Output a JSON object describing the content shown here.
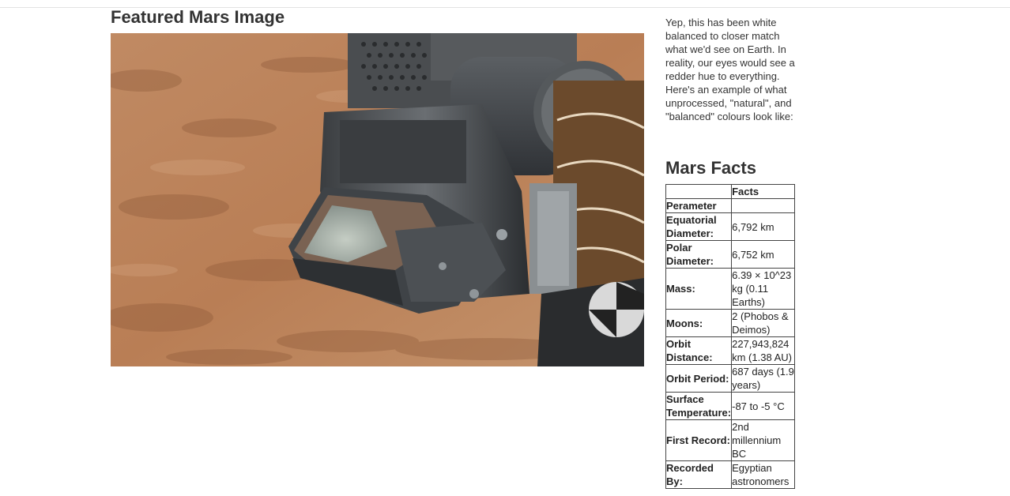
{
  "featured": {
    "title": "Featured Mars Image",
    "image_alt": "Curiosity rover scoop holding sampled soil against Martian terrain"
  },
  "note": {
    "text": "Yep, this has been white balanced to closer match what we'd see on Earth. In reality, our eyes would see a redder hue to everything. Here's an example of what unprocessed, \"natural\", and \"balanced\" colours look like:"
  },
  "facts": {
    "title": "Mars Facts",
    "header": [
      "",
      "Facts"
    ],
    "rows": [
      {
        "label": "Perameter",
        "value": ""
      },
      {
        "label": "Equatorial Diameter:",
        "value": "6,792 km"
      },
      {
        "label": "Polar Diameter:",
        "value": "6,752 km"
      },
      {
        "label": "Mass:",
        "value": "6.39 × 10^23 kg (0.11 Earths)"
      },
      {
        "label": "Moons:",
        "value": "2 (Phobos & Deimos)"
      },
      {
        "label": "Orbit Distance:",
        "value": "227,943,824 km (1.38 AU)"
      },
      {
        "label": "Orbit Period:",
        "value": "687 days (1.9 years)"
      },
      {
        "label": "Surface Temperature:",
        "value": "-87 to -5 °C"
      },
      {
        "label": "First Record:",
        "value": "2nd millennium BC"
      },
      {
        "label": "Recorded By:",
        "value": "Egyptian astronomers"
      }
    ]
  }
}
